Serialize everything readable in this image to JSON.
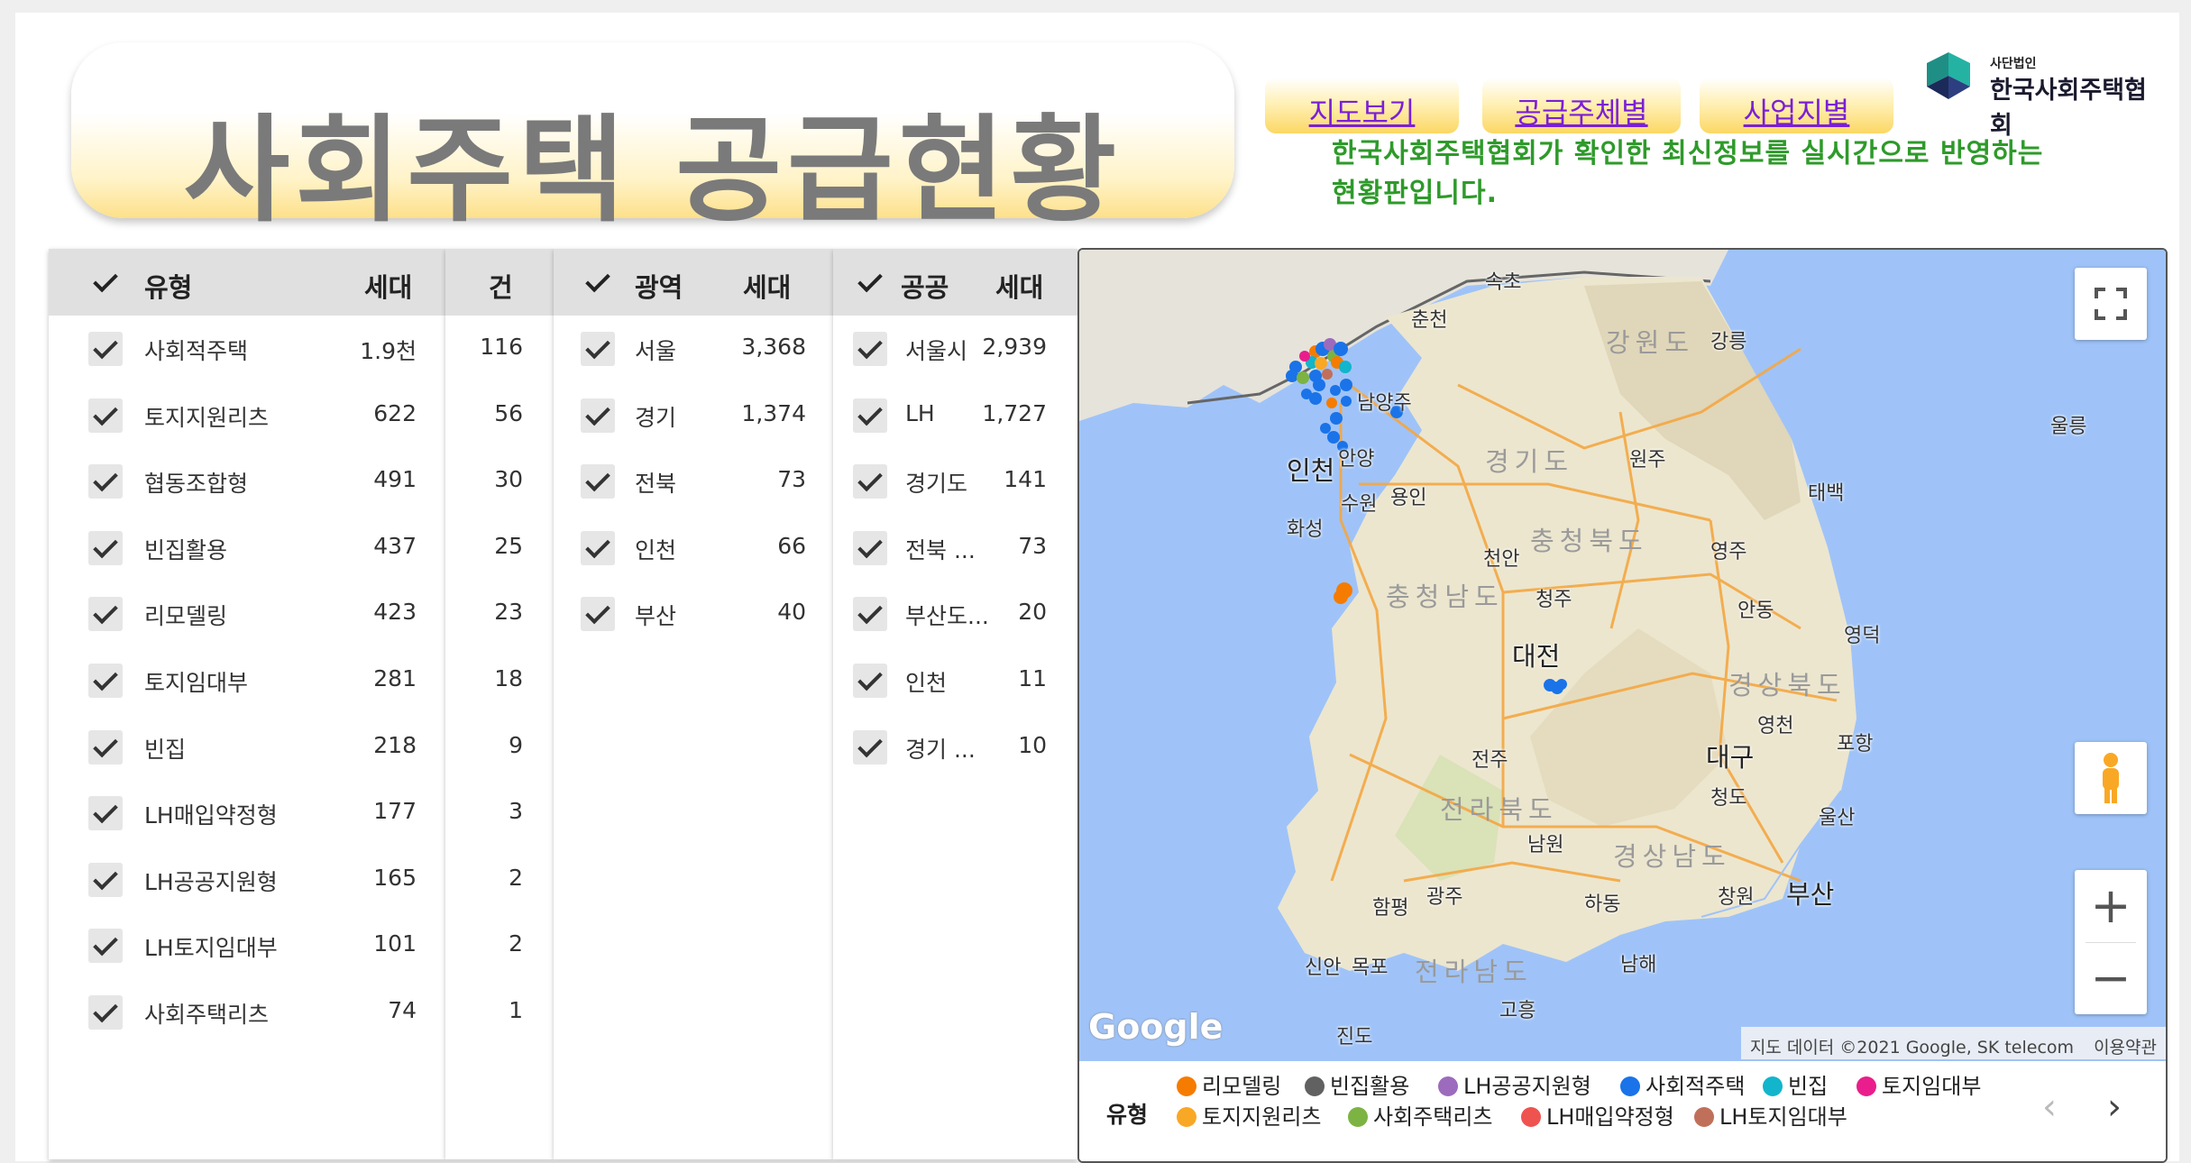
{
  "header": {
    "title": "사회주택 공급현황",
    "nav": [
      {
        "label": "지도보기"
      },
      {
        "label": "공급주체별"
      },
      {
        "label": "사업지별"
      }
    ],
    "logo_sub": "사단법인",
    "logo_name": "한국사회주택협회",
    "notice_line1": "한국사회주택협회가 확인한 최신정보를 실시간으로 반영하는",
    "notice_line2": "현황판입니다."
  },
  "type_table": {
    "headers": {
      "type": "유형",
      "households": "세대",
      "count": "건"
    },
    "rows": [
      {
        "name": "사회적주택",
        "households": "1.9천",
        "count": "116"
      },
      {
        "name": "토지지원리츠",
        "households": "622",
        "count": "56"
      },
      {
        "name": "협동조합형",
        "households": "491",
        "count": "30"
      },
      {
        "name": "빈집활용",
        "households": "437",
        "count": "25"
      },
      {
        "name": "리모델링",
        "households": "423",
        "count": "23"
      },
      {
        "name": "토지임대부",
        "households": "281",
        "count": "18"
      },
      {
        "name": "빈집",
        "households": "218",
        "count": "9"
      },
      {
        "name": "LH매입약정형",
        "households": "177",
        "count": "3"
      },
      {
        "name": "LH공공지원형",
        "households": "165",
        "count": "2"
      },
      {
        "name": "LH토지임대부",
        "households": "101",
        "count": "2"
      },
      {
        "name": "사회주택리츠",
        "households": "74",
        "count": "1"
      }
    ]
  },
  "region_table": {
    "headers": {
      "region": "광역",
      "households": "세대"
    },
    "rows": [
      {
        "name": "서울",
        "households": "3,368"
      },
      {
        "name": "경기",
        "households": "1,374"
      },
      {
        "name": "전북",
        "households": "73"
      },
      {
        "name": "인천",
        "households": "66"
      },
      {
        "name": "부산",
        "households": "40"
      }
    ]
  },
  "public_table": {
    "headers": {
      "public": "공공",
      "households": "세대"
    },
    "rows": [
      {
        "name": "서울시",
        "households": "2,939"
      },
      {
        "name": "LH",
        "households": "1,727"
      },
      {
        "name": "경기도",
        "households": "141"
      },
      {
        "name": "전북 ...",
        "households": "73"
      },
      {
        "name": "부산도...",
        "households": "20"
      },
      {
        "name": "인천",
        "households": "11"
      },
      {
        "name": "경기 ...",
        "households": "10"
      }
    ]
  },
  "map": {
    "labels": {
      "sokcho": "속초",
      "chuncheon": "춘천",
      "gangwon": "강원도",
      "gangneung": "강릉",
      "ulleung": "울릉",
      "namyangju": "남양주",
      "incheon": "인천",
      "anyang": "안양",
      "gyeonggi": "경기도",
      "wonju": "원주",
      "suwon": "수원",
      "yongin": "용인",
      "taebaek": "태백",
      "hwaseong": "화성",
      "chungbuk": "충청북도",
      "cheonan": "천안",
      "yeongju": "영주",
      "chungnam": "충청남도",
      "cheongju": "청주",
      "andong": "안동",
      "yeongdeok": "영덕",
      "daejeon": "대전",
      "gyeongbuk": "경상북도",
      "yeongcheon": "영천",
      "pohang": "포항",
      "jeonju": "전주",
      "daegu": "대구",
      "jeonbuk": "전라북도",
      "cheongdo": "청도",
      "ulsan": "울산",
      "namwon": "남원",
      "gyeongnam": "경상남도",
      "hampyeong": "함평",
      "gwangju": "광주",
      "hadong": "하동",
      "changwon": "창원",
      "busan": "부산",
      "sinan": "신안",
      "mokpo": "목포",
      "jeonnam": "전라남도",
      "namhae": "남해",
      "goheung": "고흥",
      "jindo": "진도"
    },
    "google": "Google",
    "attribution": "지도 데이터 ©2021 Google, SK telecom",
    "terms": "이용약관",
    "fullscreen_icon": "fullscreen-icon",
    "pegman_icon": "pegman-icon",
    "zoom_in": "+",
    "zoom_out": "−"
  },
  "legend": {
    "title": "유형",
    "items": [
      {
        "label": "리모델링",
        "color": "#f57c00"
      },
      {
        "label": "빈집활용",
        "color": "#616161"
      },
      {
        "label": "LH공공지원형",
        "color": "#9c6bbd"
      },
      {
        "label": "사회적주택",
        "color": "#1a73e8"
      },
      {
        "label": "빈집",
        "color": "#12b5cb"
      },
      {
        "label": "토지임대부",
        "color": "#e91e8c"
      },
      {
        "label": "토지지원리츠",
        "color": "#f9a825"
      },
      {
        "label": "사회주택리츠",
        "color": "#7cb342"
      },
      {
        "label": "LH매입약정형",
        "color": "#ef5350"
      },
      {
        "label": "LH토지임대부",
        "color": "#c0705a"
      }
    ],
    "prev": "‹",
    "next": "›"
  }
}
